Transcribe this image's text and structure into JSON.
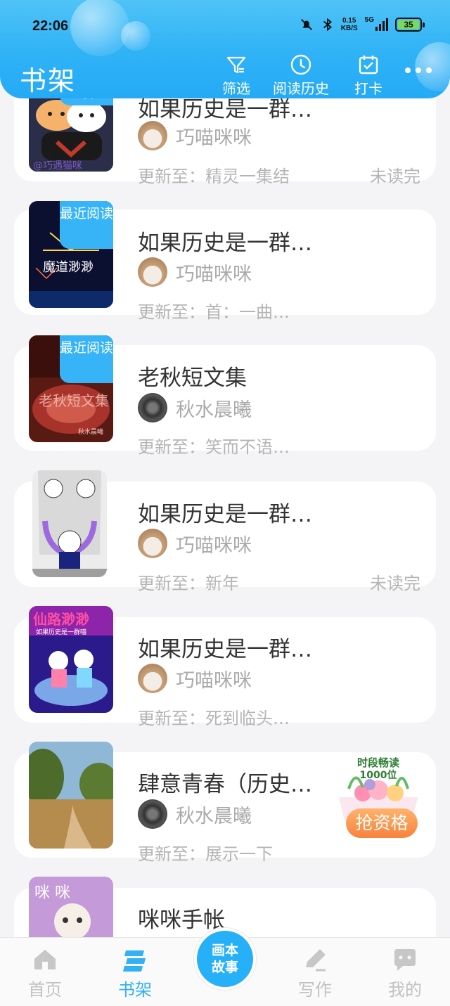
{
  "status": {
    "time": "22:06",
    "net_speed_top": "0.15",
    "net_speed_unit": "KB/S",
    "network": "5G",
    "battery": "35"
  },
  "header": {
    "title": "书架",
    "filter_label": "筛选",
    "history_label": "阅读历史",
    "checkin_label": "打卡"
  },
  "books": [
    {
      "badge": "读",
      "title": "如果历史是一群…",
      "author": "巧喵咪咪",
      "update": "更新至：精灵一集结",
      "status": "未读完"
    },
    {
      "badge": "最近阅读",
      "title": "如果历史是一群…",
      "author": "巧喵咪咪",
      "update": "更新至：首：一曲…",
      "status": ""
    },
    {
      "badge": "最近阅读",
      "title": "老秋短文集",
      "author": "秋水晨曦",
      "update": "更新至：笑而不语…",
      "status": ""
    },
    {
      "badge": "",
      "title": "如果历史是一群…",
      "author": "巧喵咪咪",
      "update": "更新至：新年",
      "status": "未读完"
    },
    {
      "badge": "",
      "title": "如果历史是一群…",
      "author": "巧喵咪咪",
      "update": "更新至：死到临头…",
      "status": ""
    },
    {
      "badge": "",
      "title": "肆意青春（历史…",
      "author": "秋水晨曦",
      "update": "更新至：展示一下",
      "status": ""
    },
    {
      "badge": "",
      "title": "咪咪手帐",
      "author": "",
      "update": "",
      "status": ""
    }
  ],
  "covers": {
    "c2": "魔道渺渺",
    "c3": "老秋短文集",
    "c3_author": "秋水晨曦",
    "c5_title": "仙路渺渺",
    "c5_sub": "如果历史是一群喵",
    "c7": "咪 咪"
  },
  "promo": {
    "line1": "时段畅读",
    "line2": "1000位",
    "button": "抢资格"
  },
  "nav": {
    "home": "首页",
    "shelf": "书架",
    "center_line1": "画本",
    "center_line2": "故事",
    "write": "写作",
    "mine": "我的"
  },
  "colors": {
    "accent": "#33b1f5",
    "header": "#2fb2f6",
    "badge": "#36b4f7"
  }
}
